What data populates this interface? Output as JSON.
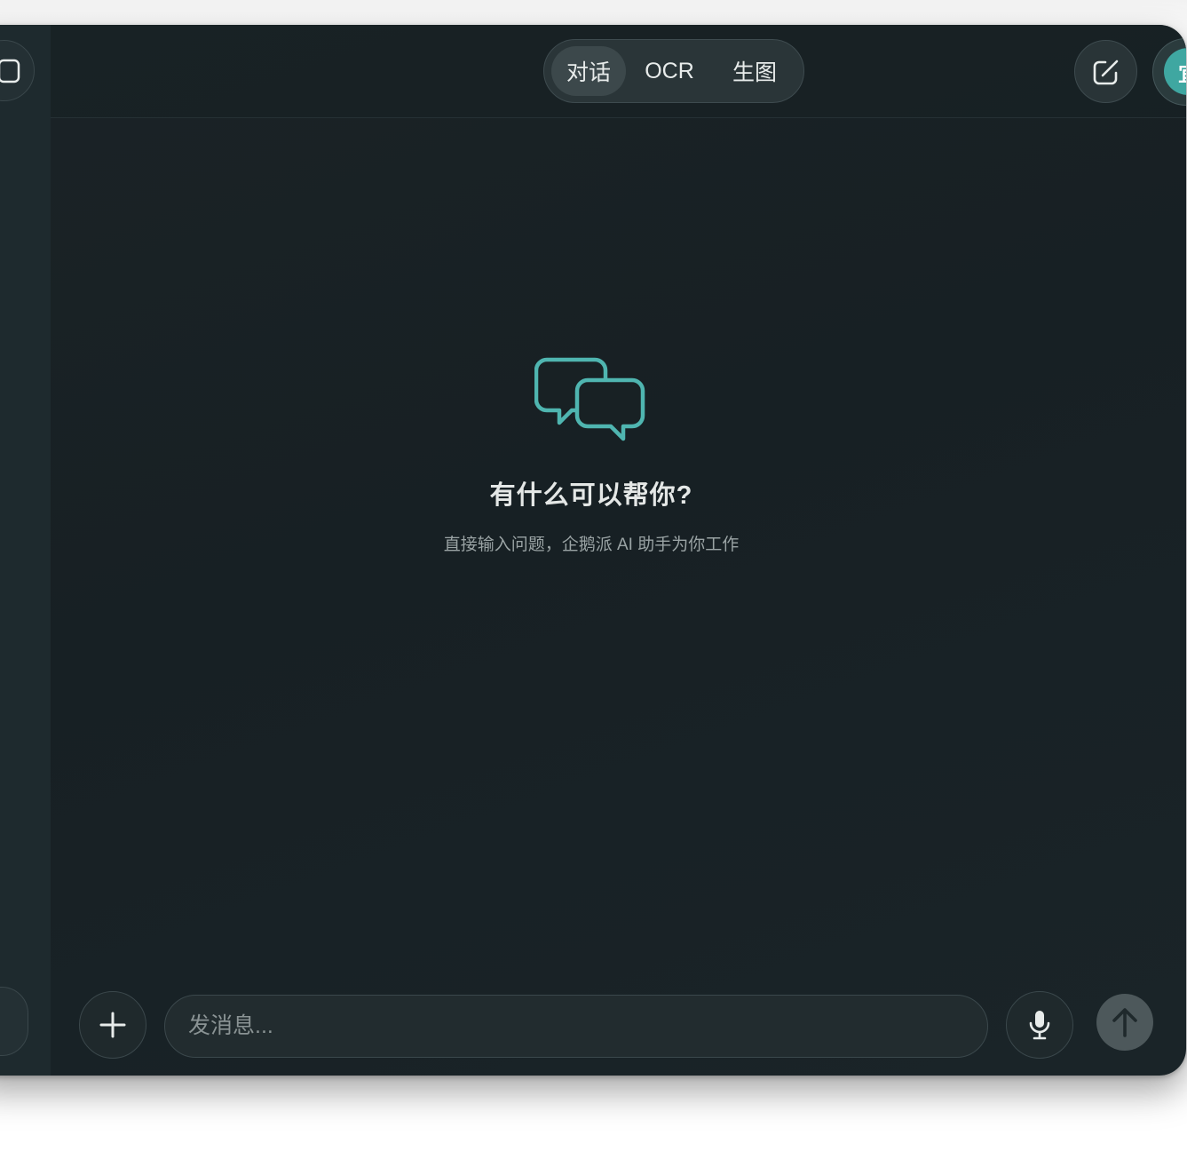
{
  "app": {
    "accent_color": "#4fb5b0",
    "background_color": "#182124"
  },
  "header": {
    "mode_tabs": [
      {
        "label": "对话",
        "active": true
      },
      {
        "label": "OCR",
        "active": false
      },
      {
        "label": "生图",
        "active": false
      }
    ],
    "compose_icon": "edit-icon",
    "avatar_text": "宜"
  },
  "sidebar": {
    "toggle_icon": "sidebar-toggle-icon"
  },
  "empty_state": {
    "icon": "chat-bubbles-icon",
    "title": "有什么可以帮你?",
    "subtitle": "直接输入问题，企鹅派 AI 助手为你工作"
  },
  "composer": {
    "add_icon": "plus-icon",
    "placeholder": "发消息...",
    "value": "",
    "mic_icon": "microphone-icon",
    "send_icon": "arrow-up-icon"
  }
}
